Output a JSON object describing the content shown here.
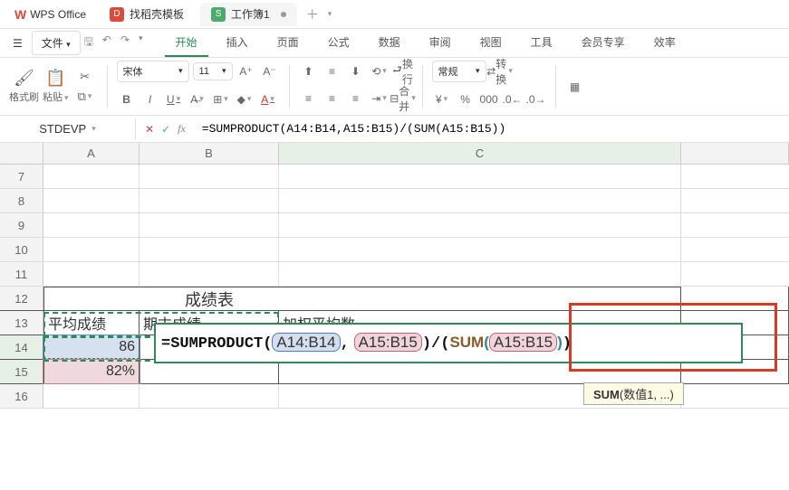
{
  "app": {
    "name": "WPS Office"
  },
  "tabs": [
    {
      "icon": "D",
      "label": "找稻壳模板"
    },
    {
      "icon": "S",
      "label": "工作簿1",
      "active": true
    }
  ],
  "file_menu": "文件",
  "menu_tabs": [
    "开始",
    "插入",
    "页面",
    "公式",
    "数据",
    "审阅",
    "视图",
    "工具",
    "会员专享",
    "效率"
  ],
  "active_menu": "开始",
  "toolbar": {
    "format_brush": "格式刷",
    "paste": "粘贴",
    "font_name": "宋体",
    "font_size": "11",
    "wrap": "换行",
    "merge": "合并",
    "numfmt": "常规",
    "convert": "转换"
  },
  "name_box": "STDEVP",
  "formula_bar": "=SUMPRODUCT(A14:B14,A15:B15)/(SUM(A15:B15))",
  "columns": [
    "A",
    "B",
    "C"
  ],
  "visible_rows": [
    "7",
    "8",
    "9",
    "10",
    "11",
    "12",
    "13",
    "14",
    "15",
    "16"
  ],
  "table": {
    "title": "成绩表",
    "headers": [
      "平均成绩",
      "期末成绩",
      "加权平均数"
    ],
    "A14": "86",
    "A15": "82%"
  },
  "edit_formula": {
    "prefix": "=SUMPRODUCT(",
    "r1": "A14:B14",
    "comma": ",",
    "r2": "A15:B15",
    "mid": ")/(",
    "kw": "SUM",
    "p1": "(",
    "r3": "A15:B15",
    "p2": ")",
    "tail": ")"
  },
  "tooltip": {
    "fn": "SUM",
    "sig": "(数值1, ...)"
  }
}
